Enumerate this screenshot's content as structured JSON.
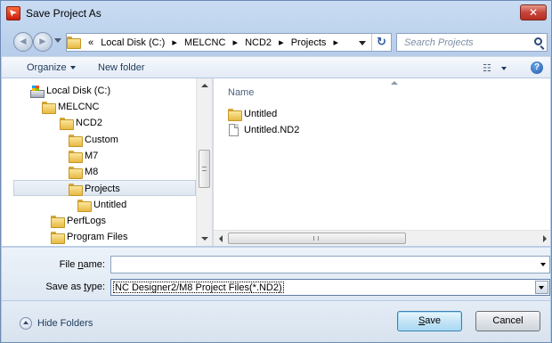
{
  "window": {
    "title": "Save Project As",
    "close_label": "✕"
  },
  "nav": {
    "back_glyph": "◄",
    "forward_glyph": "►",
    "breadcrumb": [
      "«",
      "Local Disk (C:)",
      "▸",
      "MELCNC",
      "▸",
      "NCD2",
      "▸",
      "Projects",
      "▸"
    ],
    "refresh_glyph": "↻",
    "search_placeholder": "Search Projects"
  },
  "toolbar": {
    "organize": "Organize",
    "new_folder": "New folder",
    "views_glyph": "☷"
  },
  "tree": {
    "items": [
      {
        "label": "Local Disk (C:)",
        "icon": "drive-icon"
      },
      {
        "label": "MELCNC",
        "icon": "folder-icon"
      },
      {
        "label": "NCD2",
        "icon": "folder-icon"
      },
      {
        "label": "Custom",
        "icon": "folder-icon"
      },
      {
        "label": "M7",
        "icon": "folder-icon"
      },
      {
        "label": "M8",
        "icon": "folder-icon"
      },
      {
        "label": "Projects",
        "icon": "folder-icon",
        "selected": true
      },
      {
        "label": "Untitled",
        "icon": "folder-icon"
      },
      {
        "label": "PerfLogs",
        "icon": "folder-icon"
      },
      {
        "label": "Program Files",
        "icon": "folder-icon"
      }
    ]
  },
  "files": {
    "column_name": "Name",
    "items": [
      {
        "label": "Untitled",
        "icon": "folder-icon"
      },
      {
        "label": "Untitled.ND2",
        "icon": "document-icon"
      }
    ]
  },
  "form": {
    "file_name_label_pre": "File ",
    "file_name_label_key": "n",
    "file_name_label_post": "ame:",
    "file_name_value": "",
    "save_type_label_pre": "Save as ",
    "save_type_label_key": "t",
    "save_type_label_post": "ype:",
    "save_type_value": "NC Designer2/M8 Project Files(*.ND2)"
  },
  "footer": {
    "hide_folders": "Hide Folders",
    "save_key": "S",
    "save_rest": "ave",
    "cancel": "Cancel"
  },
  "colors": {
    "title_bg": "#c9dcf3",
    "close_red": "#c7443a",
    "selection": "#dde6f0",
    "folder": "#e7b944"
  }
}
